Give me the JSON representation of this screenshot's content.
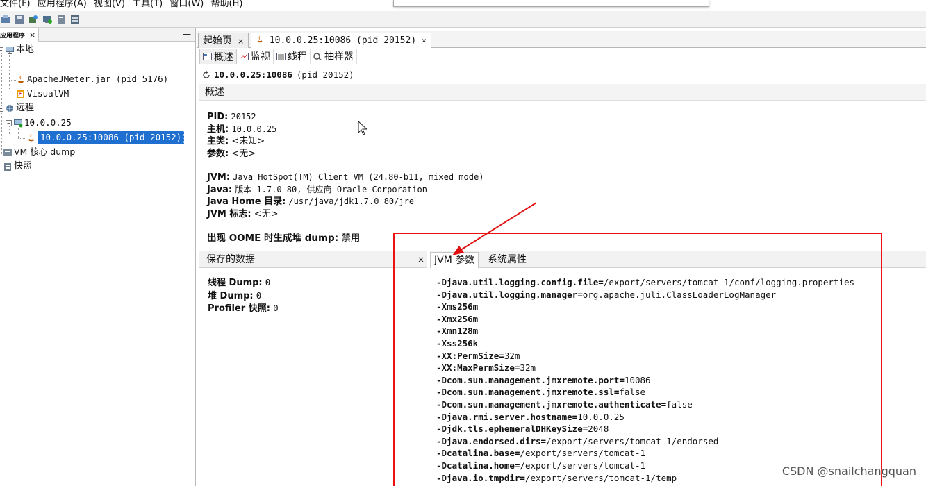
{
  "menu": {
    "items": [
      "文件(F)",
      "应用程序(A)",
      "视图(V)",
      "工具(T)",
      "窗口(W)",
      "帮助(H)"
    ]
  },
  "toolbar": {
    "icons": [
      "load-icon",
      "save-icon",
      "add-jmx-icon",
      "add-host-icon",
      "add-snapshot-icon",
      "add-coredump-icon"
    ]
  },
  "sidebar": {
    "tab_label": "应用程序",
    "tab_close": "×",
    "minimize": "—",
    "local_label": "本地",
    "jmeter_label": "ApacheJMeter.jar (pid 5176)",
    "visualvm_label": "VisualVM",
    "remote_label": "远程",
    "host_label": "10.0.0.25",
    "remote_app_label": "10.0.0.25:10086 (pid 20152)",
    "vm_dump_label": "VM 核心 dump",
    "snapshots_label": "快照"
  },
  "doc_tabs": {
    "start_label": "起始页",
    "start_close": "×",
    "app_label": "10.0.0.25:10086 (pid 20152)",
    "app_close": "×"
  },
  "sub_tabs": {
    "overview": "概述",
    "monitor": "监视",
    "threads": "线程",
    "sampler": "抽样器"
  },
  "overview": {
    "title_host": "10.0.0.25:10086",
    "title_pid": "(pid 20152)",
    "section_label": "概述",
    "pid_key": "PID:",
    "pid_val": "20152",
    "host_key": "主机:",
    "host_val": "10.0.0.25",
    "main_class_key": "主类:",
    "main_class_val": "<未知>",
    "args_key": "参数:",
    "args_val": "<无>",
    "jvm_key": "JVM:",
    "jvm_val": "Java HotSpot(TM) Client VM (24.80-b11, mixed mode)",
    "java_key": "Java:",
    "java_val": "版本 1.7.0_80, 供应商 Oracle Corporation",
    "java_home_key": "Java Home 目录:",
    "java_home_val": "/usr/java/jdk1.7.0_80/jre",
    "jvm_flags_key": "JVM 标志:",
    "jvm_flags_val": "<无>",
    "oome_key": "出现 OOME 时生成堆 dump:",
    "oome_val": "禁用"
  },
  "saved_data": {
    "header": "保存的数据",
    "close": "×",
    "thread_dump_key": "线程 Dump:",
    "thread_dump_val": "0",
    "heap_dump_key": "堆 Dump:",
    "heap_dump_val": "0",
    "profiler_key": "Profiler 快照:",
    "profiler_val": "0"
  },
  "jvm_panel": {
    "tab_jvm_args": "JVM 参数",
    "tab_sys_props": "系统属性",
    "args": [
      {
        "k": "-Djava.util.logging.config.file=",
        "v": "/export/servers/tomcat-1/conf/logging.properties"
      },
      {
        "k": "-Djava.util.logging.manager=",
        "v": "org.apache.juli.ClassLoaderLogManager"
      },
      {
        "k": "-Xms256m",
        "v": ""
      },
      {
        "k": "-Xmx256m",
        "v": ""
      },
      {
        "k": "-Xmn128m",
        "v": ""
      },
      {
        "k": "-Xss256k",
        "v": ""
      },
      {
        "k": "-XX:PermSize=",
        "v": "32m"
      },
      {
        "k": "-XX:MaxPermSize=",
        "v": "32m"
      },
      {
        "k": "-Dcom.sun.management.jmxremote.port=",
        "v": "10086"
      },
      {
        "k": "-Dcom.sun.management.jmxremote.ssl=",
        "v": "false"
      },
      {
        "k": "-Dcom.sun.management.jmxremote.authenticate=",
        "v": "false"
      },
      {
        "k": "-Djava.rmi.server.hostname=",
        "v": "10.0.0.25"
      },
      {
        "k": "-Djdk.tls.ephemeralDHKeySize=",
        "v": "2048"
      },
      {
        "k": "-Djava.endorsed.dirs=",
        "v": "/export/servers/tomcat-1/endorsed"
      },
      {
        "k": "-Dcatalina.base=",
        "v": "/export/servers/tomcat-1"
      },
      {
        "k": "-Dcatalina.home=",
        "v": "/export/servers/tomcat-1"
      },
      {
        "k": "-Djava.io.tmpdir=",
        "v": "/export/servers/tomcat-1/temp"
      }
    ]
  },
  "annotation": {
    "color": "#e01010"
  },
  "watermark": "CSDN @snailchangquan"
}
